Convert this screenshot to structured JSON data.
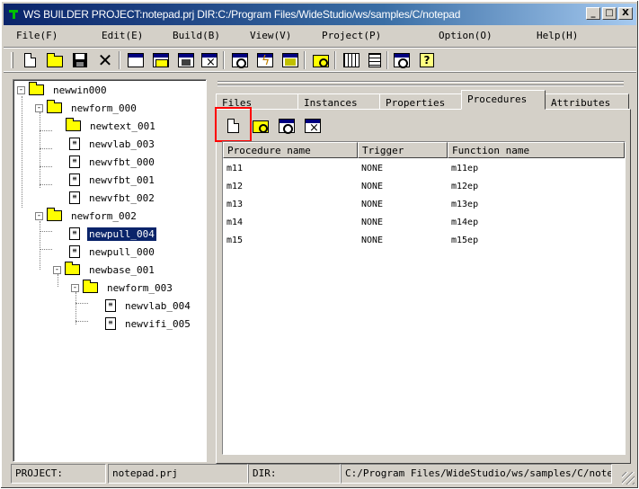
{
  "window": {
    "title": "WS BUILDER PROJECT:notepad.prj DIR:C:/Program Files/WideStudio/ws/samples/C/notepad",
    "min_label": "_",
    "max_label": "□",
    "close_label": "X"
  },
  "menu": [
    "File(F)",
    "Edit(E)",
    "Build(B)",
    "View(V)",
    "Project(P)",
    "Option(O)",
    "Help(H)"
  ],
  "toolbar_icons": [
    "new-doc-icon",
    "open-folder-icon",
    "save-disk-icon",
    "cut-x-icon",
    "new-window-icon",
    "open-window-icon",
    "save-window-icon",
    "close-window-icon",
    "preview-window-icon",
    "build-lightning-icon",
    "edit-window-icon",
    "search-folder-icon",
    "grid-icon",
    "list-icon",
    "find-icon",
    "help-icon"
  ],
  "tree": [
    {
      "label": "newwin000",
      "type": "folder",
      "depth": 0,
      "expander": "-"
    },
    {
      "label": "newform_000",
      "type": "folder",
      "depth": 1,
      "expander": "-"
    },
    {
      "label": "newtext_001",
      "type": "folder",
      "depth": 2
    },
    {
      "label": "newvlab_003",
      "type": "file",
      "depth": 2
    },
    {
      "label": "newvfbt_000",
      "type": "file",
      "depth": 2
    },
    {
      "label": "newvfbt_001",
      "type": "file",
      "depth": 2
    },
    {
      "label": "newvfbt_002",
      "type": "file",
      "depth": 2
    },
    {
      "label": "newform_002",
      "type": "folder",
      "depth": 1,
      "expander": "-"
    },
    {
      "label": "newpull_004",
      "type": "file",
      "depth": 2,
      "selected": true
    },
    {
      "label": "newpull_000",
      "type": "file",
      "depth": 2
    },
    {
      "label": "newbase_001",
      "type": "folder",
      "depth": 2,
      "expander": "-"
    },
    {
      "label": "newform_003",
      "type": "folder",
      "depth": 3,
      "expander": "-"
    },
    {
      "label": "newvlab_004",
      "type": "file",
      "depth": 4
    },
    {
      "label": "newvifi_005",
      "type": "file",
      "depth": 4
    }
  ],
  "tabs": [
    "Files",
    "Instances",
    "Properties",
    "Procedures",
    "Attributes"
  ],
  "active_tab": "Procedures",
  "panel_icons": [
    "new-procedure-icon",
    "open-procedure-icon",
    "edit-procedure-icon",
    "delete-procedure-icon"
  ],
  "grid": {
    "columns": [
      "Procedure name",
      "Trigger",
      "Function name"
    ],
    "rows": [
      [
        "m11",
        "NONE",
        "m11ep"
      ],
      [
        "m12",
        "NONE",
        "m12ep"
      ],
      [
        "m13",
        "NONE",
        "m13ep"
      ],
      [
        "m14",
        "NONE",
        "m14ep"
      ],
      [
        "m15",
        "NONE",
        "m15ep"
      ]
    ]
  },
  "status": {
    "project_label": "PROJECT:",
    "project_value": "notepad.prj",
    "dir_label": "DIR:",
    "dir_value": "C:/Program Files/WideStudio/ws/samples/C/note"
  }
}
